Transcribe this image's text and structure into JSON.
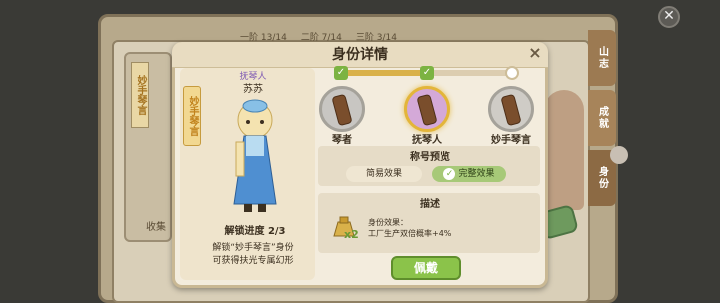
{
  "background": {
    "tiers": [
      "一阶 13/14",
      "二阶 7/14",
      "三阶 3/14"
    ],
    "left_card_tag": "妙手琴言",
    "left_card_collect": "收集",
    "side_tabs": [
      "山志",
      "成就",
      "身份"
    ]
  },
  "modal": {
    "title": "身份详情",
    "close": "×"
  },
  "character": {
    "rank": "抚琴人",
    "name": "苏苏",
    "tag": "妙手琴言",
    "unlock_progress": "解锁进度 2/3",
    "unlock_desc_line1": "解锁“妙手琴言”身份",
    "unlock_desc_line2": "可获得扶光专属幻形"
  },
  "identities": [
    {
      "label": "琴者",
      "unlocked": true
    },
    {
      "label": "抚琴人",
      "unlocked": true
    },
    {
      "label": "妙手琴言",
      "unlocked": false
    }
  ],
  "title_preview": {
    "heading": "称号预览",
    "simple_effect": "简易效果",
    "full_effect": "完整效果"
  },
  "description": {
    "heading": "描述",
    "multiplier": "x2",
    "line1": "身份效果：",
    "line2": "工厂生产双倍概率+4%"
  },
  "wear_button": "佩戴",
  "colors": {
    "accent_green": "#8bc34a",
    "gold": "#d9b14a"
  }
}
